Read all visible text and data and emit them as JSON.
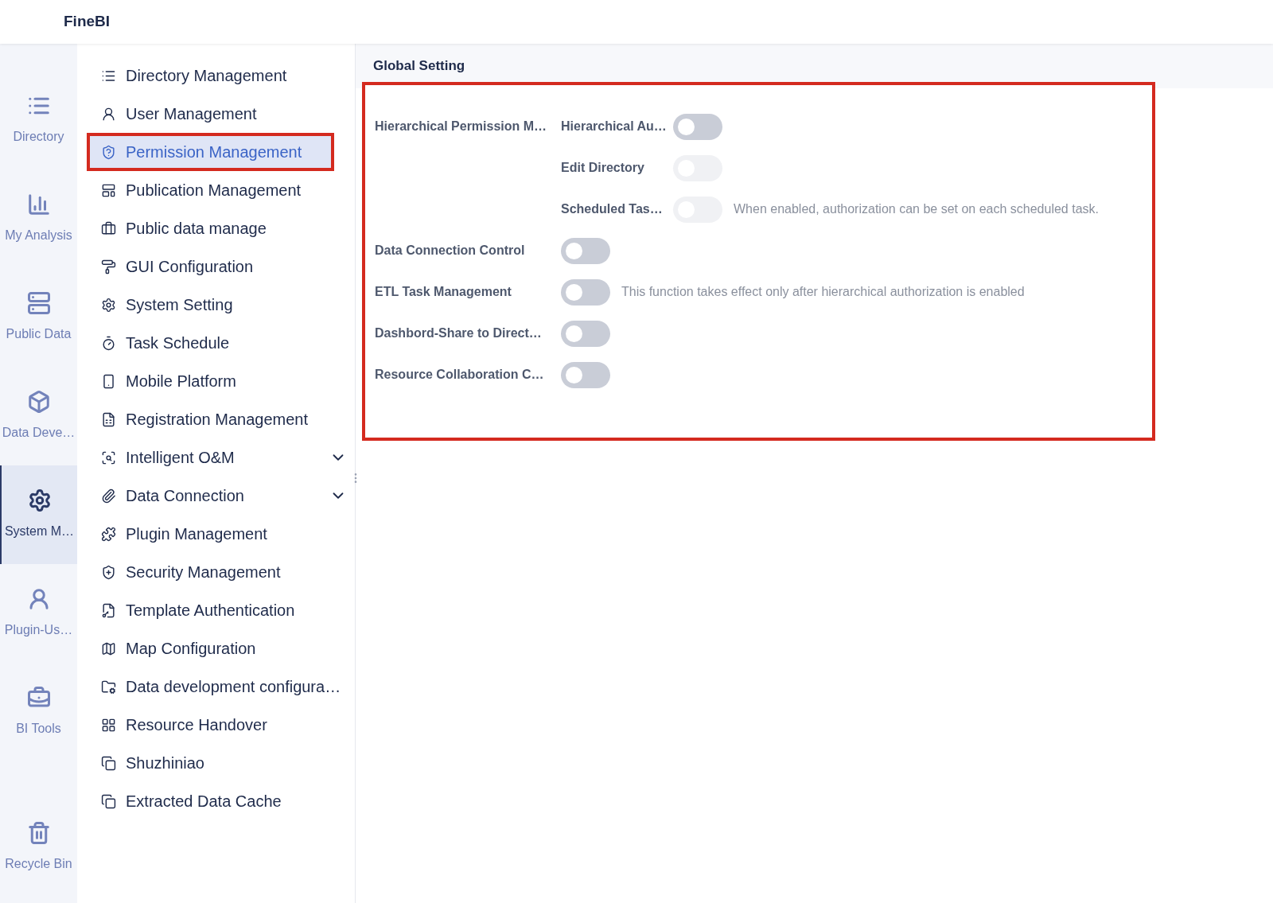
{
  "header": {
    "logo": "FineBI"
  },
  "rail": [
    {
      "label": "Directory",
      "selected": false
    },
    {
      "label": "My Analysis",
      "selected": false
    },
    {
      "label": "Public Data",
      "selected": false
    },
    {
      "label": "Data Deve…",
      "selected": false
    },
    {
      "label": "System M…",
      "selected": true
    },
    {
      "label": "Plugin-Us…",
      "selected": false
    },
    {
      "label": "BI Tools",
      "selected": false
    }
  ],
  "rail_bottom": {
    "label": "Recycle Bin",
    "selected": false
  },
  "menu": [
    {
      "label": "Directory Management",
      "selected": false,
      "highlighted": false
    },
    {
      "label": "User Management",
      "selected": false,
      "highlighted": false
    },
    {
      "label": "Permission Management",
      "selected": true,
      "highlighted": true
    },
    {
      "label": "Publication Management",
      "selected": false,
      "highlighted": false
    },
    {
      "label": "Public data manage",
      "selected": false,
      "highlighted": false
    },
    {
      "label": "GUI Configuration",
      "selected": false,
      "highlighted": false
    },
    {
      "label": "System Setting",
      "selected": false,
      "highlighted": false
    },
    {
      "label": "Task Schedule",
      "selected": false,
      "highlighted": false
    },
    {
      "label": "Mobile Platform",
      "selected": false,
      "highlighted": false
    },
    {
      "label": "Registration Management",
      "selected": false,
      "highlighted": false
    },
    {
      "label": "Intelligent O&M",
      "selected": false,
      "highlighted": false,
      "expanded": false
    },
    {
      "label": "Data Connection",
      "selected": false,
      "highlighted": false,
      "expanded": false
    },
    {
      "label": "Plugin Management",
      "selected": false,
      "highlighted": false
    },
    {
      "label": "Security Management",
      "selected": false,
      "highlighted": false
    },
    {
      "label": "Template Authentication",
      "selected": false,
      "highlighted": false
    },
    {
      "label": "Map Configuration",
      "selected": false,
      "highlighted": false
    },
    {
      "label": "Data development configura…",
      "selected": false,
      "highlighted": false
    },
    {
      "label": "Resource Handover",
      "selected": false,
      "highlighted": false
    },
    {
      "label": "Shuzhiniao",
      "selected": false,
      "highlighted": false
    },
    {
      "label": "Extracted Data Cache",
      "selected": false,
      "highlighted": false
    }
  ],
  "settings": {
    "title": "Global Setting",
    "highlighted": true,
    "rows": [
      {
        "label": "Hierarchical Permission M…",
        "sublabel": "Hierarchical Au…",
        "on": false,
        "disabled": false
      },
      {
        "sublabel": "Edit Directory",
        "on": false,
        "disabled": true
      },
      {
        "sublabel": "Scheduled Tas…",
        "on": false,
        "disabled": true,
        "note": "When enabled, authorization can be set on each scheduled task."
      },
      {
        "label": "Data Connection Control",
        "on": false,
        "disabled": false
      },
      {
        "label": "ETL Task Management",
        "on": false,
        "disabled": false,
        "note": "This function takes effect only after hierarchical authorization is enabled"
      },
      {
        "label": "Dashbord-Share to Direct…",
        "on": false,
        "disabled": false
      },
      {
        "label": "Resource Collaboration C…",
        "on": false,
        "disabled": false
      }
    ]
  }
}
